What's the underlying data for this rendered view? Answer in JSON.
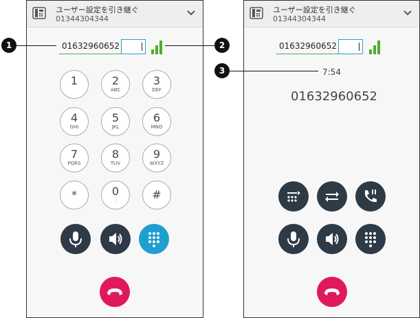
{
  "left": {
    "header": {
      "title": "ユーザー設定を引き継ぐ",
      "number": "01344304344"
    },
    "dial_number": "01632960652",
    "keypad": [
      {
        "digit": "1",
        "letters": ""
      },
      {
        "digit": "2",
        "letters": "ABC"
      },
      {
        "digit": "3",
        "letters": "DEF"
      },
      {
        "digit": "4",
        "letters": "GHI"
      },
      {
        "digit": "5",
        "letters": "JKL"
      },
      {
        "digit": "6",
        "letters": "MNO"
      },
      {
        "digit": "7",
        "letters": "PQRS"
      },
      {
        "digit": "8",
        "letters": "TUV"
      },
      {
        "digit": "9",
        "letters": "WXYZ"
      },
      {
        "digit": "*",
        "letters": ""
      },
      {
        "digit": "0",
        "letters": "."
      },
      {
        "digit": "#",
        "letters": ""
      }
    ]
  },
  "right": {
    "header": {
      "title": "ユーザー設定を引き継ぐ",
      "number": "01344304344"
    },
    "dial_number": "01632960652",
    "timer": "7:54",
    "remote_number": "01632960652"
  },
  "callouts": [
    "1",
    "2",
    "3"
  ],
  "colors": {
    "accent": "#1e9fd0",
    "hangup": "#e0195a",
    "dark_button": "#2e3a45",
    "signal": "#4cae2c"
  }
}
